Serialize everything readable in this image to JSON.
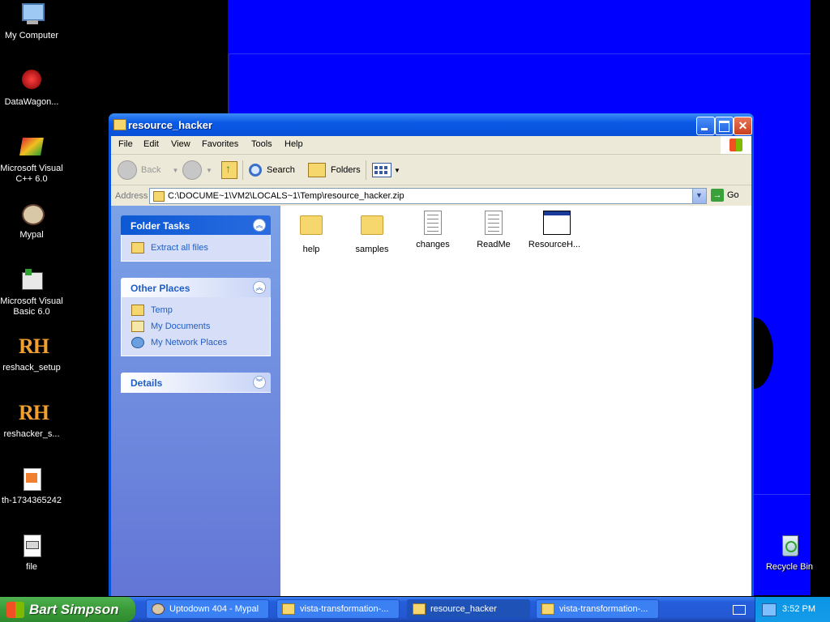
{
  "desktop": {
    "icons": [
      {
        "label": "My Computer",
        "icon": "computer-icon"
      },
      {
        "label": "DataWagon...",
        "icon": "datawagon-icon"
      },
      {
        "label": "Microsoft Visual C++ 6.0",
        "icon": "visual-cpp-icon"
      },
      {
        "label": "Mypal",
        "icon": "mypal-icon"
      },
      {
        "label": "Microsoft Visual Basic 6.0",
        "icon": "visual-basic-icon"
      },
      {
        "label": "reshack_setup",
        "icon": "rh-icon",
        "glyph": "RH"
      },
      {
        "label": "reshacker_s...",
        "icon": "rh-icon",
        "glyph": "RH"
      },
      {
        "label": "th-1734365242",
        "icon": "image-file-icon"
      },
      {
        "label": "file",
        "icon": "file-icon"
      },
      {
        "label": "Recycle Bin",
        "icon": "recycle-bin-icon"
      }
    ]
  },
  "window": {
    "title": "resource_hacker",
    "menu": [
      "File",
      "Edit",
      "View",
      "Favorites",
      "Tools",
      "Help"
    ],
    "toolbar": {
      "back": "Back",
      "search": "Search",
      "folders": "Folders"
    },
    "address": {
      "label": "Address",
      "value": "C:\\DOCUME~1\\VM2\\LOCALS~1\\Temp\\resource_hacker.zip",
      "go": "Go"
    },
    "folder_tasks": {
      "title": "Folder Tasks",
      "items": [
        "Extract all files"
      ]
    },
    "other_places": {
      "title": "Other Places",
      "items": [
        "Temp",
        "My Documents",
        "My Network Places"
      ]
    },
    "details": {
      "title": "Details"
    },
    "files": [
      {
        "name": "help",
        "type": "folder"
      },
      {
        "name": "samples",
        "type": "folder"
      },
      {
        "name": "changes",
        "type": "text-document"
      },
      {
        "name": "ReadMe",
        "type": "text-document"
      },
      {
        "name": "ResourceH...",
        "type": "application"
      }
    ]
  },
  "taskbar": {
    "start_label": "Bart Simpson",
    "tasks": [
      {
        "label": "Uptodown 404 - Mypal",
        "active": false
      },
      {
        "label": "vista-transformation-...",
        "active": false
      },
      {
        "label": "resource_hacker",
        "active": true
      },
      {
        "label": "vista-transformation-...",
        "active": false
      }
    ],
    "clock": "3:52 PM"
  },
  "colors": {
    "desktop_blue": "#0000ff",
    "titlebar_blue": "#0a5ae6",
    "taskbar_blue": "#245edb",
    "start_green": "#3a9a38",
    "link_blue": "#215dc6"
  }
}
